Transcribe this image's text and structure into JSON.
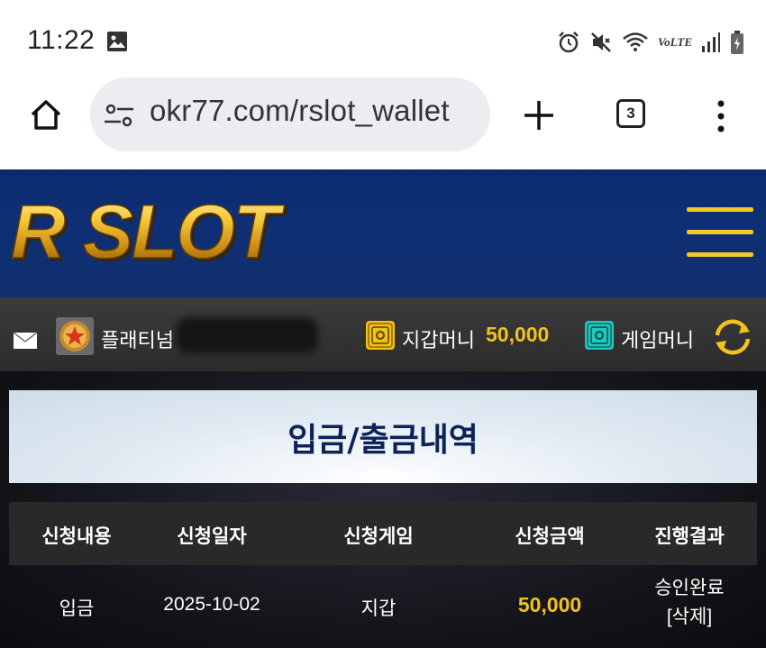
{
  "status_bar": {
    "time": "11:22",
    "volte": "VoLTE",
    "icons": [
      "image-icon",
      "alarm-icon",
      "mute-icon",
      "wifi-icon",
      "volte-icon",
      "signal-icon",
      "battery-icon"
    ]
  },
  "browser": {
    "url": "okr77.com/rslot_wallet",
    "tab_count": "3"
  },
  "header": {
    "logo_text": "R SLOT"
  },
  "user_bar": {
    "rank_label": "플래티넘",
    "wallet_label": "지갑머니",
    "wallet_value": "50,000",
    "game_label": "게임머니"
  },
  "page": {
    "title": "입금/출금내역"
  },
  "table": {
    "headers": [
      "신청내용",
      "신청일자",
      "신청게임",
      "신청금액",
      "진행결과"
    ],
    "rows": [
      {
        "type": "입금",
        "date": "2025-10-02",
        "game": "지갑",
        "amount": "50,000",
        "status": "승인완료",
        "action": "[삭제]"
      }
    ]
  },
  "colors": {
    "brand_blue": "#0e2f76",
    "gold": "#f4c21a",
    "teal": "#1fc9c0"
  }
}
